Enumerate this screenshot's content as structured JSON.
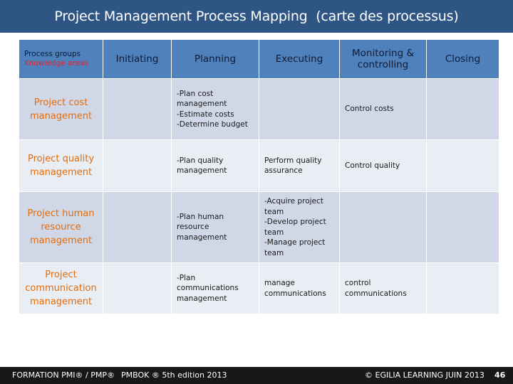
{
  "slide": {
    "title": "Project Management Process Mapping  (carte des processus)"
  },
  "table": {
    "corner": {
      "process_groups_label": "Process groups",
      "knowledge_areas_label": "Knowledge areas"
    },
    "headers": [
      "Initiating",
      "Planning",
      "Executing",
      "Monitoring & controlling",
      "Closing"
    ],
    "rows": [
      {
        "area": [
          "Project cost",
          "management"
        ],
        "initiating": [],
        "planning": [
          "-Plan cost",
          "management",
          "-Estimate costs",
          "-Determine budget"
        ],
        "executing": [],
        "monitoring": [
          "Control costs"
        ],
        "closing": []
      },
      {
        "area": [
          "Project quality",
          "management"
        ],
        "initiating": [],
        "planning": [
          "-Plan quality",
          "management"
        ],
        "executing": [
          "Perform quality",
          "assurance"
        ],
        "monitoring": [
          "Control quality"
        ],
        "closing": []
      },
      {
        "area": [
          "Project human",
          "resource",
          "management"
        ],
        "initiating": [],
        "planning": [
          "-Plan human",
          "resource",
          "management"
        ],
        "executing": [
          "-Acquire project",
          "team",
          "-Develop project",
          "team",
          "-Manage project",
          "team"
        ],
        "monitoring": [],
        "closing": []
      },
      {
        "area": [
          "Project",
          "communication",
          "management"
        ],
        "initiating": [],
        "planning": [
          "-Plan communications",
          "management"
        ],
        "executing": [
          "manage",
          "communications"
        ],
        "monitoring": [
          "control",
          "communications"
        ],
        "closing": []
      }
    ]
  },
  "footer": {
    "left": "FORMATION PMI® / PMP®",
    "middle": "PMBOK ® 5th edition  2013",
    "right": "© EGILIA LEARNING  JUIN 2013",
    "page_number": "46"
  },
  "colors": {
    "title_bar": "#2f5584",
    "header_fill": "#4f81bd",
    "row_band_dark": "#d0d8e8",
    "row_band_light": "#e9edf4",
    "knowledge_area_text": "#e46c0a",
    "knowledge_areas_label": "#e8202a",
    "footer_bar": "#181818"
  }
}
